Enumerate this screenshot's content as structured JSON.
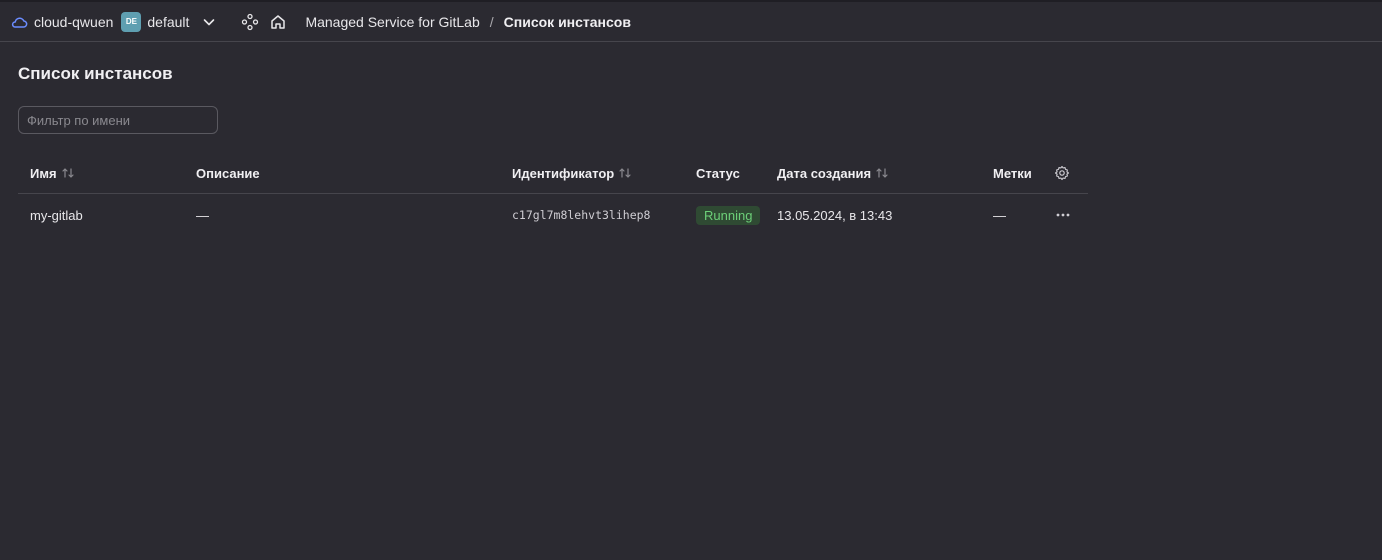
{
  "topbar": {
    "cloud_name": "cloud-qwuen",
    "folder_badge": "DE",
    "folder_name": "default",
    "breadcrumb_service": "Managed Service for GitLab",
    "breadcrumb_separator": "/",
    "breadcrumb_current": "Список инстансов",
    "icons": [
      "cloud-icon",
      "chevron-down-icon",
      "services-icon",
      "home-icon"
    ]
  },
  "page": {
    "title": "Список инстансов",
    "filter_placeholder": "Фильтр по имени"
  },
  "table": {
    "columns": {
      "name": "Имя",
      "description": "Описание",
      "id": "Идентификатор",
      "status": "Статус",
      "created": "Дата создания",
      "labels": "Метки"
    },
    "rows": [
      {
        "name": "my-gitlab",
        "description": "—",
        "id": "c17gl7m8lehvt3lihep8",
        "status": "Running",
        "created": "13.05.2024, в 13:43",
        "labels": "—"
      }
    ]
  },
  "colors": {
    "background": "#2b2a31",
    "status_running_bg": "#2f4a33",
    "status_running_text": "#6ccf78",
    "folder_badge": "#5f9fb1",
    "cloud_icon": "#6b8cff"
  }
}
